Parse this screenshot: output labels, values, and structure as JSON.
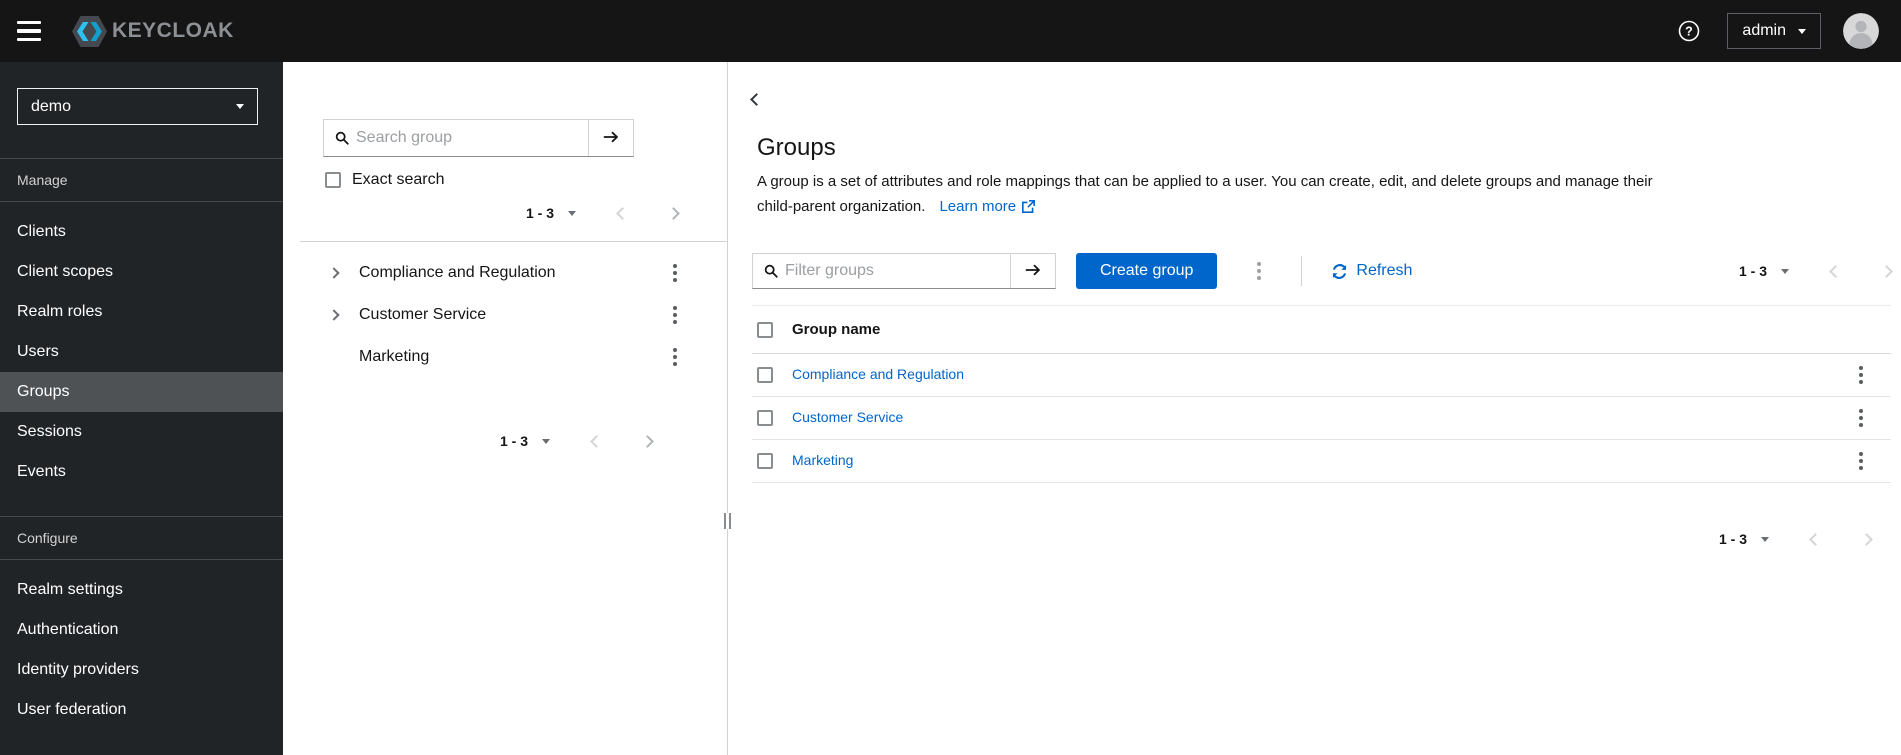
{
  "masthead": {
    "brand": "KEYCLOAK",
    "username": "admin"
  },
  "sidebar": {
    "realm": "demo",
    "sections": [
      {
        "label": "Manage",
        "items": [
          {
            "label": "Clients"
          },
          {
            "label": "Client scopes"
          },
          {
            "label": "Realm roles"
          },
          {
            "label": "Users"
          },
          {
            "label": "Groups",
            "selected": true
          },
          {
            "label": "Sessions"
          },
          {
            "label": "Events"
          }
        ]
      },
      {
        "label": "Configure",
        "items": [
          {
            "label": "Realm settings"
          },
          {
            "label": "Authentication"
          },
          {
            "label": "Identity providers"
          },
          {
            "label": "User federation"
          }
        ]
      }
    ]
  },
  "tree_panel": {
    "search_placeholder": "Search group",
    "exact_search_label": "Exact search",
    "pagination_label": "1 - 3",
    "pagination_bottom_label": "1 - 3",
    "items": [
      {
        "label": "Compliance and Regulation",
        "expandable": true
      },
      {
        "label": "Customer Service",
        "expandable": true
      },
      {
        "label": "Marketing",
        "expandable": false
      }
    ]
  },
  "main": {
    "title": "Groups",
    "description_line1": "A group is a set of attributes and role mappings that can be applied to a user. You can create, edit, and delete groups and manage their",
    "description_line2": "child-parent organization.",
    "learn_more_label": "Learn more",
    "toolbar": {
      "filter_placeholder": "Filter groups",
      "create_button_label": "Create group",
      "refresh_label": "Refresh",
      "pagination_label": "1 - 3"
    },
    "table": {
      "columns": [
        "Group name"
      ],
      "rows": [
        {
          "name": "Compliance and Regulation"
        },
        {
          "name": "Customer Service"
        },
        {
          "name": "Marketing"
        }
      ]
    },
    "pagination_bottom_label": "1 - 3"
  },
  "colors": {
    "primary": "#0066cc",
    "link": "#0066cc",
    "masthead_bg": "#151515",
    "sidebar_bg": "#212427",
    "sidebar_selected_bg": "#4f5255",
    "logo_cyan": "#29b8e4"
  }
}
